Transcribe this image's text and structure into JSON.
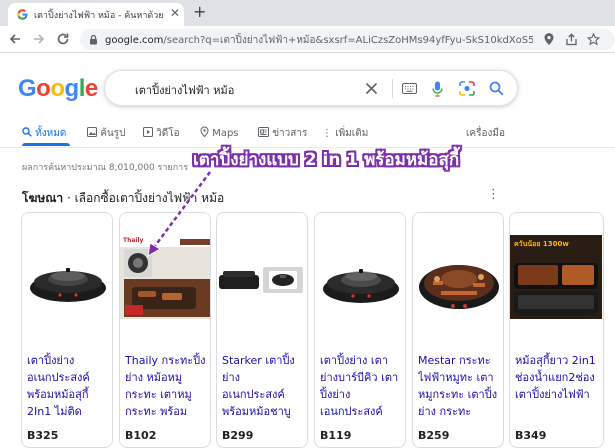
{
  "browser": {
    "tab_title": "เตาปิ้งย่างไฟฟ้า หม้อ - ค้นหาด้วย Goo",
    "url_host": "google.com",
    "url_rest": "/search?q=เตาปิ้งย่างไฟฟ้า+หม้อ&sxsrf=ALiCzsZoHMs94yfFyu-SkS10kdXoS5gHaw..."
  },
  "search": {
    "logo": "Google",
    "query": "เตาปิ้งย่างไฟฟ้า หม้อ"
  },
  "tabs": [
    {
      "label": "ทั้งหมด"
    },
    {
      "label": "ค้นรูป"
    },
    {
      "label": "วิดีโอ"
    },
    {
      "label": "Maps"
    },
    {
      "label": "ข่าวสาร"
    },
    {
      "label": "เพิ่มเติม"
    }
  ],
  "tools_label": "เครื่องมือ",
  "stats": "ผลการค้นหาประมาณ 8,010,000 รายการ",
  "annotation": "เตาปิ้งย่างแบบ 2 in 1 พร้อมหม้อสุกี้",
  "ads": {
    "label": "โฆษณา",
    "title": " · เลือกซื้อเตาปิ้งย่างไฟฟ้า หม้อ"
  },
  "products": [
    {
      "title": "เตาปิ้งย่าง อเนกประสงค์ พร้อมหม้อสุกี้ 2In1 ไม่ติดกระทะ",
      "price": "B325"
    },
    {
      "title": "Thaily กระทะปิ้งย่าง หม้อหมูกระทะ เตาหมูกระทะ พร้อม",
      "price": "B102",
      "badge": "Thaily"
    },
    {
      "title": "Starker เตาปิ้งย่าง อเนกประสงค์ พร้อมหม้อชาบู",
      "price": "B299"
    },
    {
      "title": "เตาปิ้งย่าง เตาย่างบาร์บีคิว เตาปิ้งย่าง เอนกประสงค์",
      "price": "B119"
    },
    {
      "title": "Mestar กระทะไฟฟ้าหมูทะ เตาหมูกระทะ เตาปิ้งย่าง กระทะ",
      "price": "B259"
    },
    {
      "title": "หม้อสุกี้ยาว 2in1 ช่องน้ำแยก2ช่อง เตาปิ้งย่างไฟฟ้า",
      "price": "B349",
      "badge": "ควันน้อย 1300w"
    }
  ]
}
